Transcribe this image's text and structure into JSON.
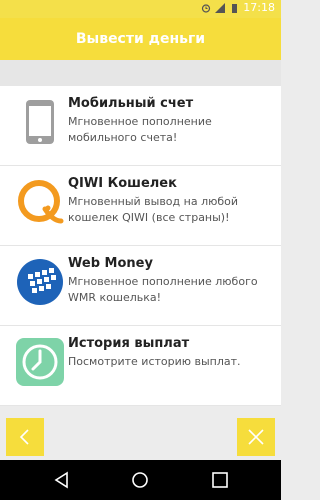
{
  "status_bar": {
    "time": "17:18",
    "icons": [
      "alarm-icon",
      "battery-icon",
      "signal-icon"
    ]
  },
  "header": {
    "title": "Вывести деньги"
  },
  "items": [
    {
      "title": "Мобильный счет",
      "description": "Мгновенное пополнение мобильного счета!",
      "icon": "phone-icon"
    },
    {
      "title": "QIWI Кошелек",
      "description": "Мгновенный вывод на любой кошелек QIWI (все страны)!",
      "icon": "qiwi-logo-icon"
    },
    {
      "title": "Web Money",
      "description": "Мгновенное пополнение любого WMR кошелька!",
      "icon": "webmoney-logo-icon"
    },
    {
      "title": "История выплат",
      "description": "Посмотрите историю выплат.",
      "icon": "clock-icon"
    }
  ],
  "bottom": {
    "back_icon": "chevron-left-icon",
    "close_icon": "close-icon"
  },
  "android_nav": {
    "back": "back-icon",
    "home": "home-icon",
    "recents": "recents-icon"
  },
  "colors": {
    "accent": "#f6dd3c",
    "qiwi": "#f39a1f",
    "webmoney": "#1e63b8",
    "history": "#7ed3a8"
  }
}
